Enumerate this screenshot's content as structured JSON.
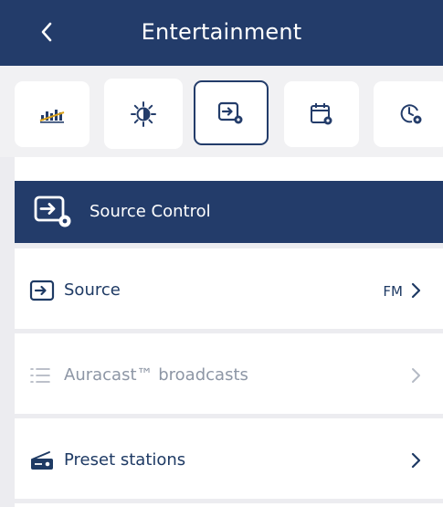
{
  "header": {
    "title": "Entertainment",
    "back_icon": "chevron-left-icon"
  },
  "tabs": [
    {
      "icon": "equalizer-icon",
      "selected": false
    },
    {
      "icon": "brightness-icon",
      "selected": false
    },
    {
      "icon": "source-settings-icon",
      "selected": true
    },
    {
      "icon": "calendar-settings-icon",
      "selected": false
    },
    {
      "icon": "timer-settings-icon",
      "selected": false
    }
  ],
  "section": {
    "title": "Source Control",
    "icon": "source-settings-icon"
  },
  "rows": [
    {
      "label": "Source",
      "value": "FM",
      "icon": "source-input-icon",
      "enabled": true
    },
    {
      "label": "Auracast™ broadcasts",
      "value": "",
      "icon": "list-icon",
      "enabled": false
    },
    {
      "label": "Preset stations",
      "value": "",
      "icon": "radio-icon",
      "enabled": true
    }
  ],
  "colors": {
    "primary": "#233c6a",
    "text": "#1e3a64",
    "disabled": "#8d96a5",
    "background": "#ececf0",
    "card": "#ffffff"
  }
}
